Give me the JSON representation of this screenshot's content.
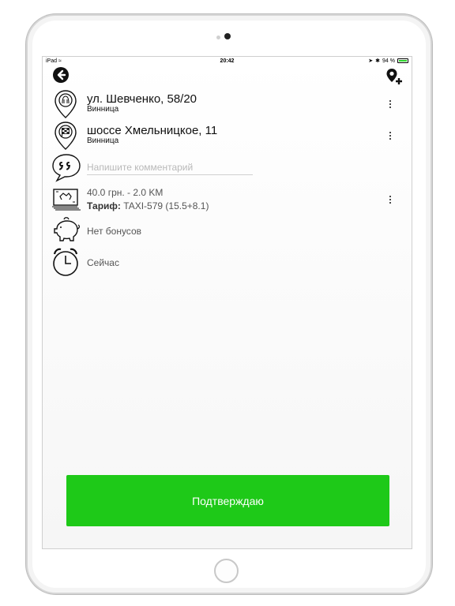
{
  "status": {
    "device": "iPad",
    "time": "20:42",
    "battery": "94 %"
  },
  "route": {
    "from": {
      "street": "ул. Шевченко, 58/20",
      "city": "Винница"
    },
    "to": {
      "street": "шоссе Хмельницкое, 11",
      "city": "Винница"
    }
  },
  "comment": {
    "placeholder": "Напишите комментарий",
    "value": ""
  },
  "fare": {
    "price": "40.0 грн. - 2.0 KM",
    "tariff_label": "Тариф:",
    "tariff_value": "TAXI-579 (15.5+8.1)"
  },
  "bonus": {
    "label": "Нет бонусов"
  },
  "time_row": {
    "label": "Сейчас"
  },
  "confirm": {
    "label": "Подтверждаю"
  },
  "colors": {
    "accent": "#1ec918"
  }
}
